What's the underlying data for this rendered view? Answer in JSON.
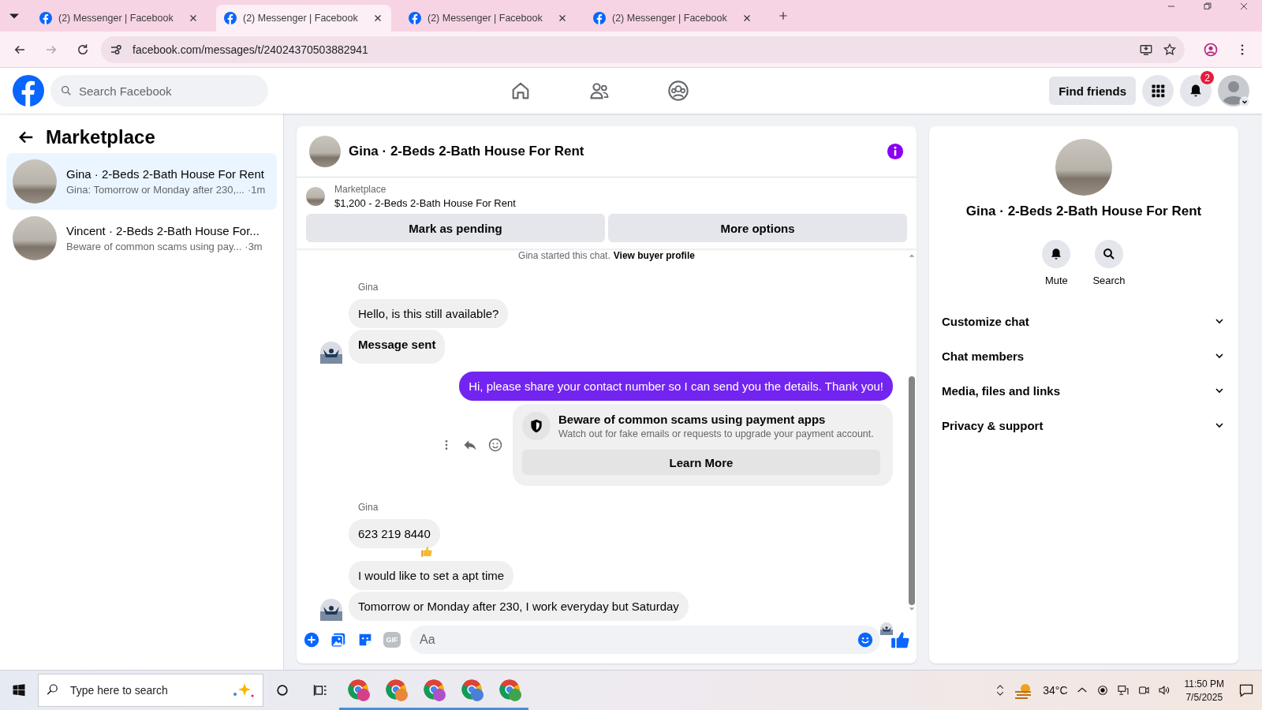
{
  "browser": {
    "tabs": [
      {
        "title": "(2) Messenger | Facebook",
        "selected": false
      },
      {
        "title": "(2) Messenger | Facebook",
        "selected": true
      },
      {
        "title": "(2) Messenger | Facebook",
        "selected": false
      },
      {
        "title": "(2) Messenger | Facebook",
        "selected": false
      }
    ],
    "url": "facebook.com/messages/t/24024370503882941"
  },
  "topbar": {
    "search": {
      "placeholder": "Search Facebook"
    },
    "find_friends": "Find friends",
    "notification_count": "2"
  },
  "sidebar": {
    "title": "Marketplace",
    "conversations": [
      {
        "name": "Gina · 2-Beds 2-Bath House For Rent",
        "preview": "Gina: Tomorrow or Monday after 230,...",
        "time": "·1m",
        "selected": true
      },
      {
        "name": "Vincent · 2-Beds 2-Bath House For...",
        "preview": "Beware of common scams using pay...",
        "time": "·3m",
        "selected": false
      }
    ]
  },
  "chat": {
    "title": "Gina · 2-Beds 2-Bath House For Rent",
    "listing": {
      "source": "Marketplace",
      "title": "$1,200 - 2-Beds 2-Bath House For Rent"
    },
    "actions": [
      "Mark as pending",
      "More options"
    ],
    "notice": "Gina started this chat.",
    "profile_link": "View buyer profile",
    "messages": [
      {
        "kind": "sender",
        "text": "Gina"
      },
      {
        "kind": "incoming",
        "text": "Hello, is this still available?",
        "bold": false,
        "avatar": false,
        "reacted": false
      },
      {
        "kind": "incoming",
        "text": "Message sent",
        "bold": true,
        "avatar": true,
        "reacted": false
      },
      {
        "kind": "outgoing",
        "text": "Hi, please share your contact number so I can send you the details. Thank you!"
      },
      {
        "kind": "warning",
        "title": "Beware of common scams using payment apps",
        "body": "Watch out for fake emails or requests to upgrade your payment account.",
        "button": "Learn More"
      },
      {
        "kind": "sender",
        "text": "Gina"
      },
      {
        "kind": "incoming",
        "text": "623 219 8440",
        "bold": false,
        "avatar": false,
        "reacted": true
      },
      {
        "kind": "incoming",
        "text": "I would like to set a apt time",
        "bold": false,
        "avatar": false,
        "reacted": false
      },
      {
        "kind": "incoming",
        "text": "Tomorrow or Monday after 230, I work everyday but Saturday",
        "bold": false,
        "avatar": true,
        "reacted": false
      }
    ],
    "composer": {
      "gif": "GIF",
      "placeholder": "Aa"
    }
  },
  "info": {
    "title": "Gina · 2-Beds 2-Bath House For Rent",
    "actions": [
      {
        "kind": "mute",
        "label": "Mute"
      },
      {
        "kind": "search",
        "label": "Search"
      }
    ],
    "sections": [
      {
        "label": "Customize chat",
        "expanded": false
      },
      {
        "label": "Chat members",
        "expanded": false
      },
      {
        "label": "Media, files and links",
        "expanded": false
      },
      {
        "label": "Privacy & support",
        "expanded": false
      }
    ]
  },
  "taskbar": {
    "search": {
      "placeholder": "Type here to search"
    },
    "apps": [
      {
        "color": "#d6408b"
      },
      {
        "color": "#e8863a"
      },
      {
        "color": "#b04fc8"
      },
      {
        "color": "#4a7fd8"
      },
      {
        "color": "#3fa34d"
      }
    ],
    "temperature": "34°C",
    "time": "11:50 PM",
    "date": "7/5/2025"
  }
}
